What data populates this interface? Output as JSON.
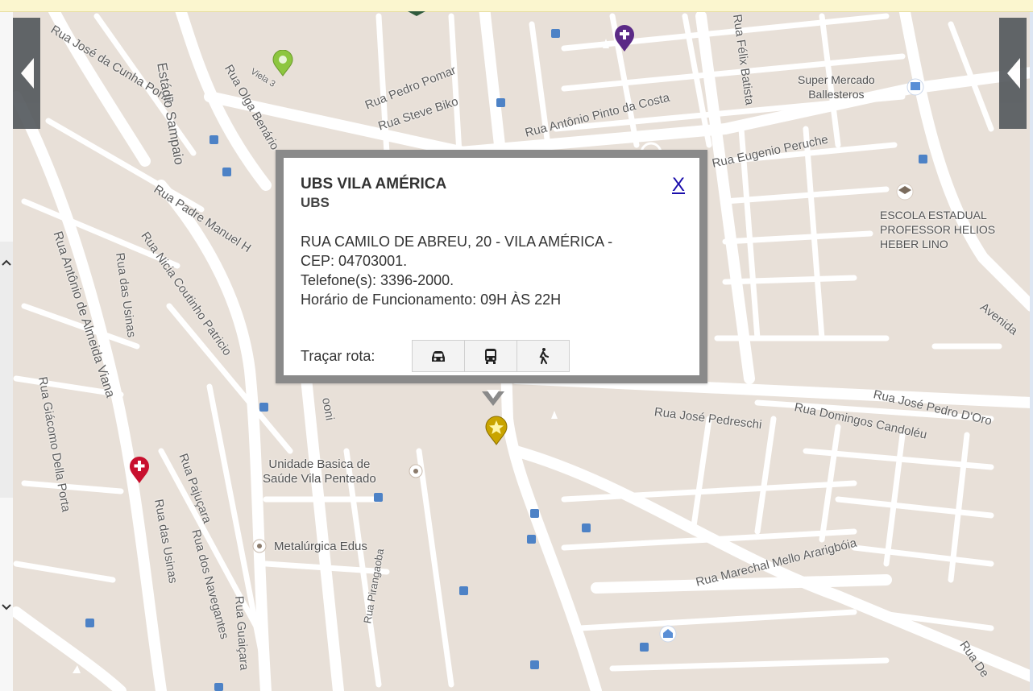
{
  "colors": {
    "map_background": "#e8e0d8",
    "street": "#ffffff",
    "popup_border": "#8a8a8a",
    "close_link": "#1a0dab",
    "selected_marker": "#c9a400",
    "hospital_marker": "#c8102e",
    "church_marker": "#5b2a86",
    "park_marker": "#8dc63f",
    "transit_marker": "#3b7bd4"
  },
  "streets": [
    "Rua José da Cunha Ponte",
    "Estádio Sampaio",
    "Viela 3",
    "Rua Olga Benário",
    "Rua Pedro Pomar",
    "Rua Steve Biko",
    "Rua Antônio Pinto da Costa",
    "Rua Félix Batista",
    "Rua Eugenio Peruche",
    "Rua Padre Manuel H",
    "Rua Antônio de Almeida Viana",
    "Rua das Usinas",
    "Rua Nicia Coutinho Patricio",
    "Rua Giácomo Della Porta",
    "Rua Pajuçara",
    "Rua das Usinas",
    "Rua dos Navegantes",
    "Rua Guaiçara",
    "Rua José Pedreschi",
    "Rua Domingos Candoléu",
    "Rua José Pedro D'Oro",
    "Rua Marechal Mello Ararigbóia",
    "Avenida",
    "Rua De",
    "Rua Pirangaoba",
    "ooni"
  ],
  "pois": {
    "supermarket": [
      "Super Mercado",
      "Ballesteros"
    ],
    "school": [
      "ESCOLA ESTADUAL",
      "PROFESSOR HELIOS",
      "HEBER LINO"
    ],
    "health_unit": [
      "Unidade Basica de",
      "Saúde Vila Penteado"
    ],
    "factory": "Metalúrgica Edus"
  },
  "popup": {
    "title": "UBS VILA AMÉRICA",
    "subtitle": "UBS",
    "close": "X",
    "address": "RUA CAMILO DE ABREU, 20 - VILA AMÉRICA -",
    "cep": "CEP: 04703001.",
    "phone": "Telefone(s): 3396-2000.",
    "hours": "Horário de Funcionamento: 09H ÀS 22H",
    "route_label": "Traçar rota:",
    "route_modes": [
      "car-icon",
      "bus-icon",
      "walk-icon"
    ]
  },
  "controls": {
    "left_panel_toggle": "chevron-left-icon",
    "right_panel_toggle": "chevron-left-icon"
  }
}
